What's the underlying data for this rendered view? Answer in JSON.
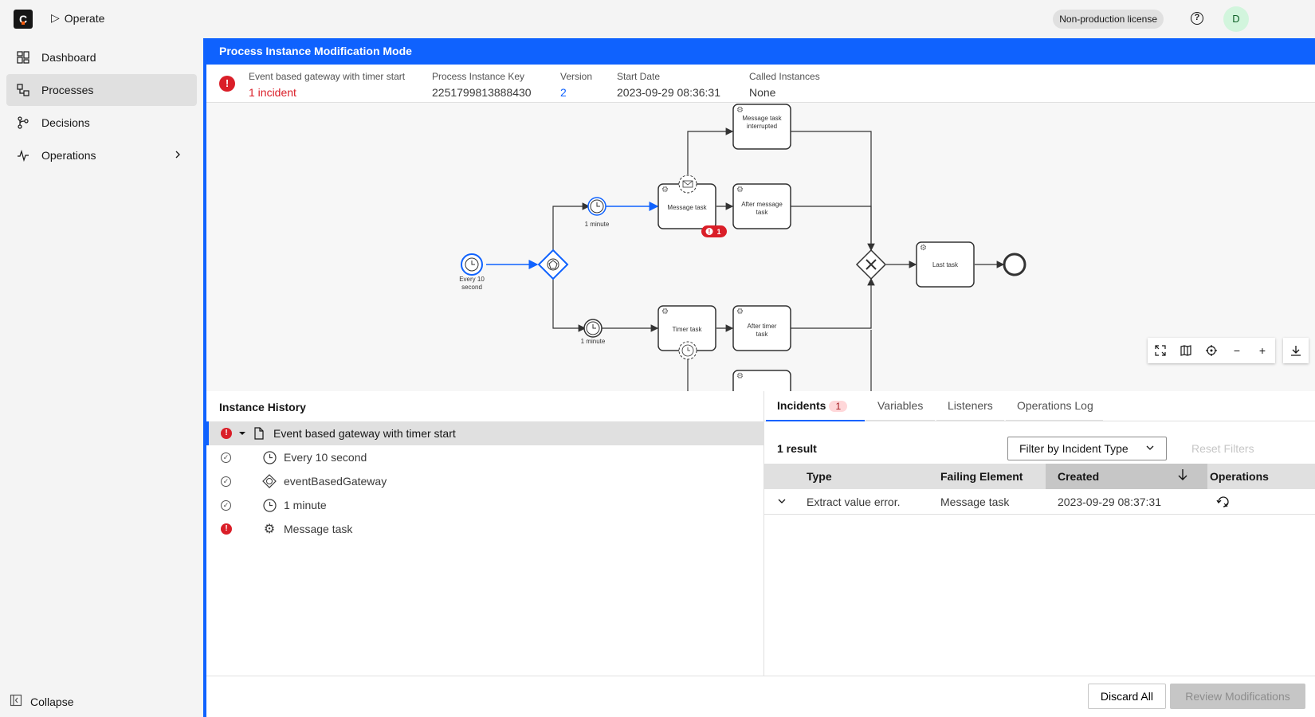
{
  "app": {
    "logo": "C",
    "name": "Operate",
    "license": "Non-production license",
    "avatar": "D"
  },
  "sidebar": {
    "items": [
      {
        "label": "Dashboard"
      },
      {
        "label": "Processes",
        "active": true
      },
      {
        "label": "Decisions"
      },
      {
        "label": "Operations"
      }
    ],
    "collapse": "Collapse"
  },
  "mode_bar": "Process Instance Modification Mode",
  "header": {
    "process_name": "Event based gateway with timer start",
    "incident_text": "1 incident",
    "key_label": "Process Instance Key",
    "key_value": "2251799813888430",
    "version_label": "Version",
    "version_value": "2",
    "start_label": "Start Date",
    "start_value": "2023-09-29 08:36:31",
    "called_label": "Called Instances",
    "called_value": "None"
  },
  "diagram": {
    "labels": {
      "start": "Every 10 second",
      "timer_top": "1 minute",
      "timer_bottom": "1 minute",
      "message_task": "Message task",
      "msg_interrupted": "Message task interrupted",
      "after_message": "After message task",
      "timer_task": "Timer task",
      "after_timer": "After timer task",
      "last_task": "Last task"
    },
    "incident_count": "1"
  },
  "history": {
    "title": "Instance History",
    "rows": [
      {
        "label": "Event based gateway with timer start",
        "status": "incident",
        "icon": "document-icon"
      },
      {
        "label": "Every 10 second",
        "status": "completed",
        "icon": "clock-icon"
      },
      {
        "label": "eventBasedGateway",
        "status": "completed",
        "icon": "gateway-icon"
      },
      {
        "label": "1 minute",
        "status": "completed",
        "icon": "clock-icon"
      },
      {
        "label": "Message task",
        "status": "incident",
        "icon": "gear-icon"
      }
    ]
  },
  "incidents": {
    "tabs": [
      {
        "label": "Incidents",
        "badge": "1"
      },
      {
        "label": "Variables"
      },
      {
        "label": "Listeners"
      },
      {
        "label": "Operations Log"
      }
    ],
    "result": "1 result",
    "filter": "Filter by Incident Type",
    "reset": "Reset Filters",
    "columns": {
      "type": "Type",
      "element": "Failing Element",
      "created": "Created",
      "operations": "Operations"
    },
    "rows": [
      {
        "type": "Extract value error.",
        "element": "Message task",
        "created": "2023-09-29 08:37:31"
      }
    ]
  },
  "footer": {
    "discard": "Discard All",
    "review": "Review Modifications"
  },
  "colors": {
    "accent": "#0f62fe",
    "error": "#da1e28"
  }
}
